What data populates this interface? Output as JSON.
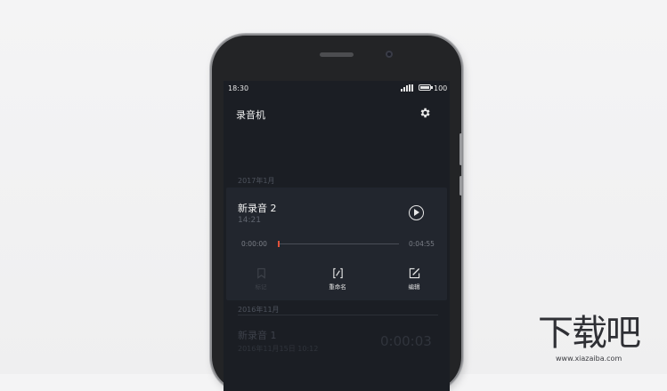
{
  "status_bar": {
    "time": "18:30",
    "battery": "100"
  },
  "app_bar": {
    "title": "录音机",
    "settings_icon": "gear-icon"
  },
  "sections": [
    {
      "label": "2017年1月"
    },
    {
      "label": "2016年11月"
    }
  ],
  "selected_recording": {
    "name": "新录音 2",
    "time": "14:21",
    "position": "0:00:00",
    "duration": "0:04:55",
    "progress": 0.0,
    "actions": [
      {
        "label": "标记",
        "icon": "bookmark-icon",
        "enabled": false
      },
      {
        "label": "重命名",
        "icon": "rename-icon",
        "enabled": true
      },
      {
        "label": "编辑",
        "icon": "edit-icon",
        "enabled": true
      }
    ]
  },
  "other_recording": {
    "name": "新录音 1",
    "subtitle": "2016年11月15日 10:12",
    "duration": "0:00:03"
  },
  "watermark": {
    "text": "下载吧",
    "url": "www.xiazaiba.com"
  },
  "colors": {
    "screen_bg": "#1b1e24",
    "card_bg": "#22262e",
    "accent": "#e0513a"
  }
}
